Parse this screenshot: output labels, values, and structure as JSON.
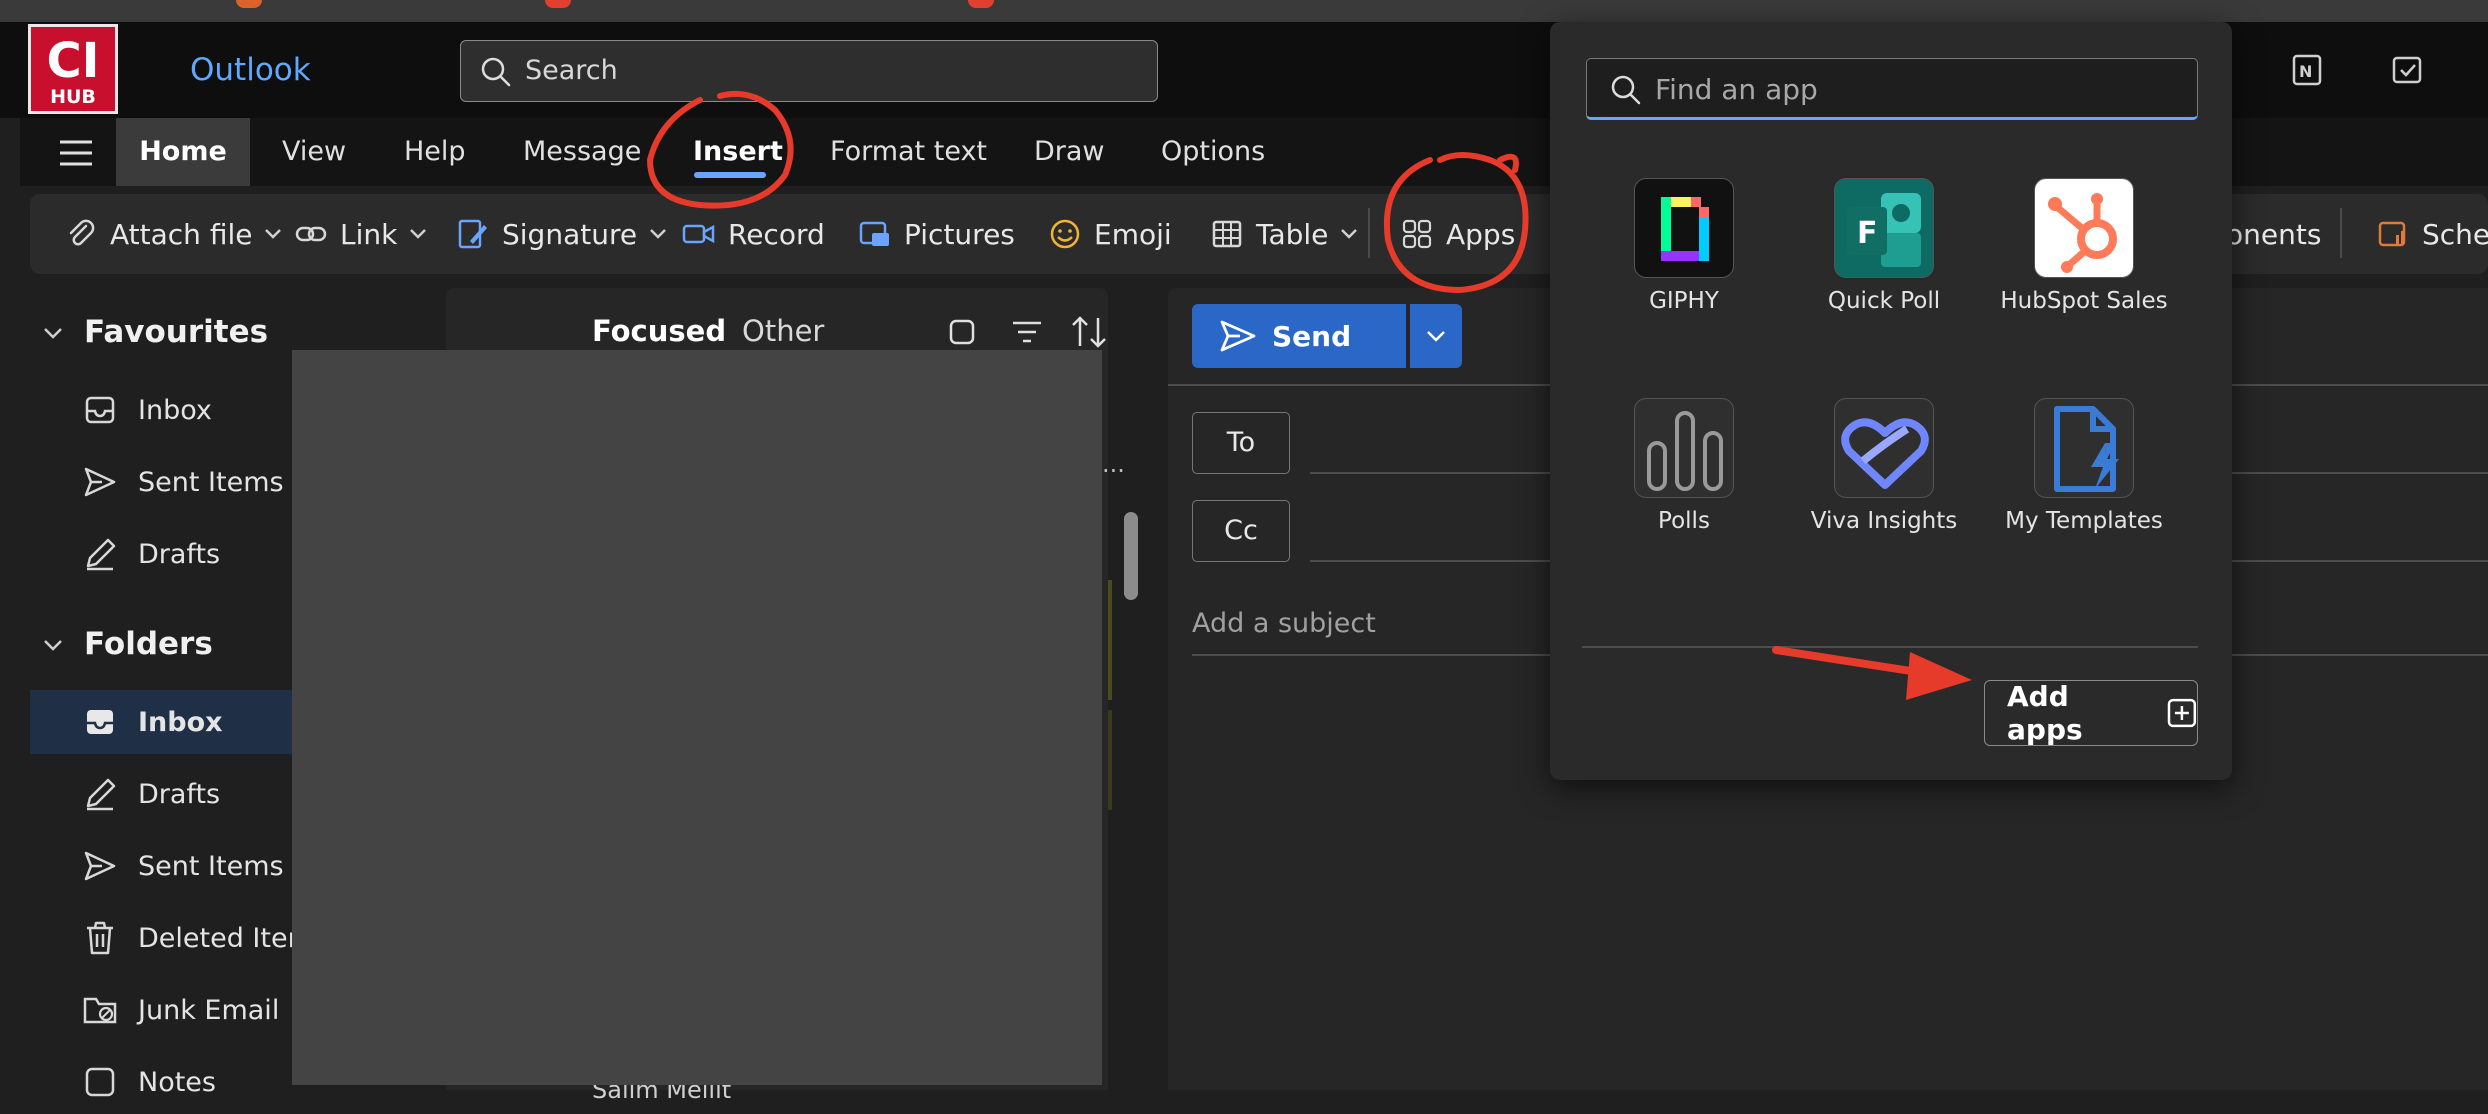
{
  "header": {
    "logo_line1": "CI",
    "logo_line2": "HUB",
    "app_title": "Outlook",
    "search_placeholder": "Search"
  },
  "menu": {
    "tabs": [
      "Home",
      "View",
      "Help",
      "Message",
      "Insert",
      "Format text",
      "Draw",
      "Options"
    ],
    "active": "Home"
  },
  "toolbar": {
    "attach_file": "Attach file",
    "link": "Link",
    "signature": "Signature",
    "record": "Record",
    "pictures": "Pictures",
    "emoji": "Emoji",
    "table": "Table",
    "apps": "Apps",
    "components_partial": "onents",
    "schedule_partial": "Sched"
  },
  "sidebar": {
    "favourites": {
      "label": "Favourites",
      "items": [
        "Inbox",
        "Sent Items",
        "Drafts"
      ]
    },
    "folders": {
      "label": "Folders",
      "items": [
        "Inbox",
        "Drafts",
        "Sent Items",
        "Deleted Item",
        "Junk Email",
        "Notes"
      ]
    }
  },
  "message_list": {
    "focused": "Focused",
    "other": "Other",
    "more": "...",
    "partial_sender": "Salim Mellit"
  },
  "compose": {
    "send": "Send",
    "to": "To",
    "cc": "Cc",
    "subject_placeholder": "Add a subject"
  },
  "apps_popup": {
    "search_placeholder": "Find an app",
    "apps": [
      {
        "name": "GIPHY"
      },
      {
        "name": "Quick Poll"
      },
      {
        "name": "HubSpot Sales"
      },
      {
        "name": "Polls"
      },
      {
        "name": "Viva Insights"
      },
      {
        "name": "My Templates"
      }
    ],
    "add_apps": "Add apps"
  },
  "colors": {
    "accent": "#2b67c7",
    "link_blue": "#5ea8ff",
    "annotation_red": "#e63a2a",
    "logo_red": "#c8102e"
  }
}
